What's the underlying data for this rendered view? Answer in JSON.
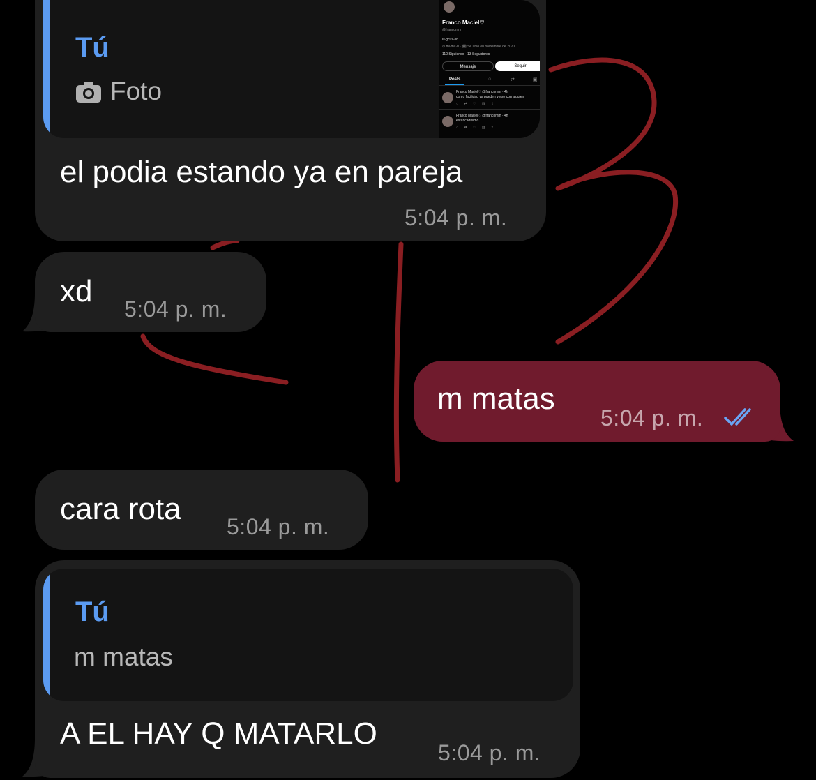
{
  "messages": [
    {
      "id": "m1",
      "direction": "incoming",
      "reply_author": "Tú",
      "reply_preview": "Foto",
      "reply_icon": "camera-icon",
      "thumbnail": {
        "profile_name": "Franco Maciel♡",
        "handle": "@francomm",
        "bio": "Ill·gcus·en",
        "meta": "⊙ mi·mu·ri · 🗓 Se unió en noviembre de 2020",
        "stats": "110 Siguiendo · 13 Seguidores",
        "message_button": "Mensaje",
        "follow_button": "Seguir",
        "tab_posts": "Posts",
        "tweet1_header": "Franco Maciel♡ @francomm · 4h",
        "tweet1_body": "con q facilidad ya pueden verse con alguien",
        "tweet2_header": "Franco Maciel♡ @francomm · 4h",
        "tweet2_body": "estancadísimo"
      },
      "text": "el podia estando ya en pareja",
      "time": "5:04 p. m."
    },
    {
      "id": "m2",
      "direction": "incoming",
      "text": "xd",
      "time": "5:04 p. m."
    },
    {
      "id": "m3",
      "direction": "outgoing",
      "text": "m matas",
      "time": "5:04 p. m.",
      "status_icon": "double-check-icon"
    },
    {
      "id": "m4",
      "direction": "incoming",
      "text": "cara rota",
      "time": "5:04 p. m."
    },
    {
      "id": "m5",
      "direction": "incoming",
      "reply_author": "Tú",
      "reply_preview": "m matas",
      "text": "A EL HAY Q MATARLO",
      "time": "5:04 p. m."
    }
  ],
  "colors": {
    "background": "#000000",
    "incoming_bubble": "#1f1f1f",
    "outgoing_bubble": "#701b2d",
    "quote_accent": "#5b9bf2",
    "read_check": "#6aa5f5",
    "doodle": "#8a1e22"
  }
}
